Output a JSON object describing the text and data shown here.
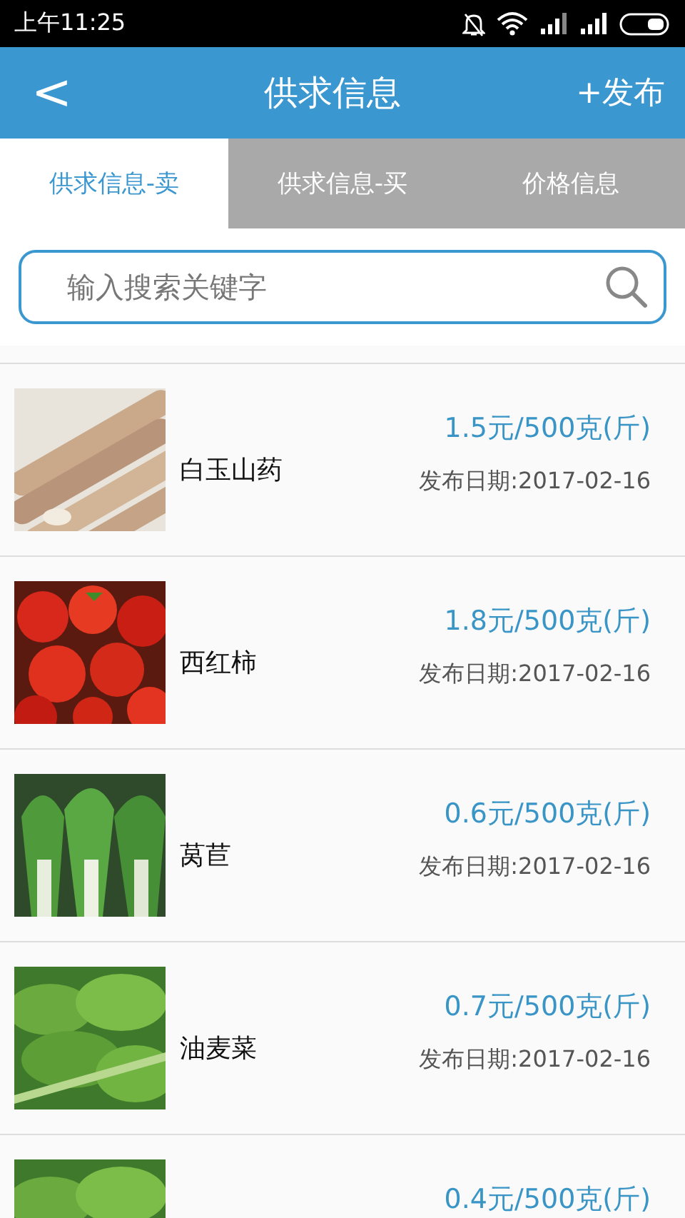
{
  "status_bar": {
    "time": "上午11:25"
  },
  "header": {
    "back": "<",
    "title": "供求信息",
    "action": "+发布"
  },
  "tabs": [
    {
      "label": "供求信息-卖",
      "selected": true
    },
    {
      "label": "供求信息-买",
      "selected": false
    },
    {
      "label": "价格信息",
      "selected": false
    }
  ],
  "search": {
    "placeholder": "输入搜索关键字"
  },
  "items": [
    {
      "name": "白玉山药",
      "price": "1.5元/500克(斤)",
      "date": "发布日期:2017-02-16"
    },
    {
      "name": "西红柿",
      "price": "1.8元/500克(斤)",
      "date": "发布日期:2017-02-16"
    },
    {
      "name": "莴苣",
      "price": "0.6元/500克(斤)",
      "date": "发布日期:2017-02-16"
    },
    {
      "name": "油麦菜",
      "price": "0.7元/500克(斤)",
      "date": "发布日期:2017-02-16"
    },
    {
      "price": "0.4元/500克(斤)"
    }
  ]
}
